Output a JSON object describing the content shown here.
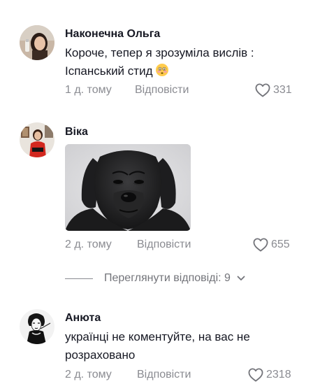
{
  "comments": [
    {
      "author": "Наконечна Ольга",
      "text_line1": "Короче, тепер я зрозуміла вислів :",
      "text_line2": "Іспанський стид",
      "emoji": "flushed-face",
      "time": "1 д. тому",
      "reply_label": "Відповісти",
      "likes": "331"
    },
    {
      "author": "Віка",
      "attachment": "dog-meme-gif",
      "time": "2 д. тому",
      "reply_label": "Відповісти",
      "likes": "655"
    },
    {
      "author": "Анюта",
      "text_line1": "українці не коментуйте, на вас не",
      "text_line2": "розраховано",
      "time": "2 д. тому",
      "reply_label": "Відповісти",
      "likes": "2318"
    }
  ],
  "view_replies_label": "Переглянути відповіді: 9",
  "colors": {
    "text": "#161823",
    "muted": "#8a8b91",
    "background": "#ffffff"
  }
}
